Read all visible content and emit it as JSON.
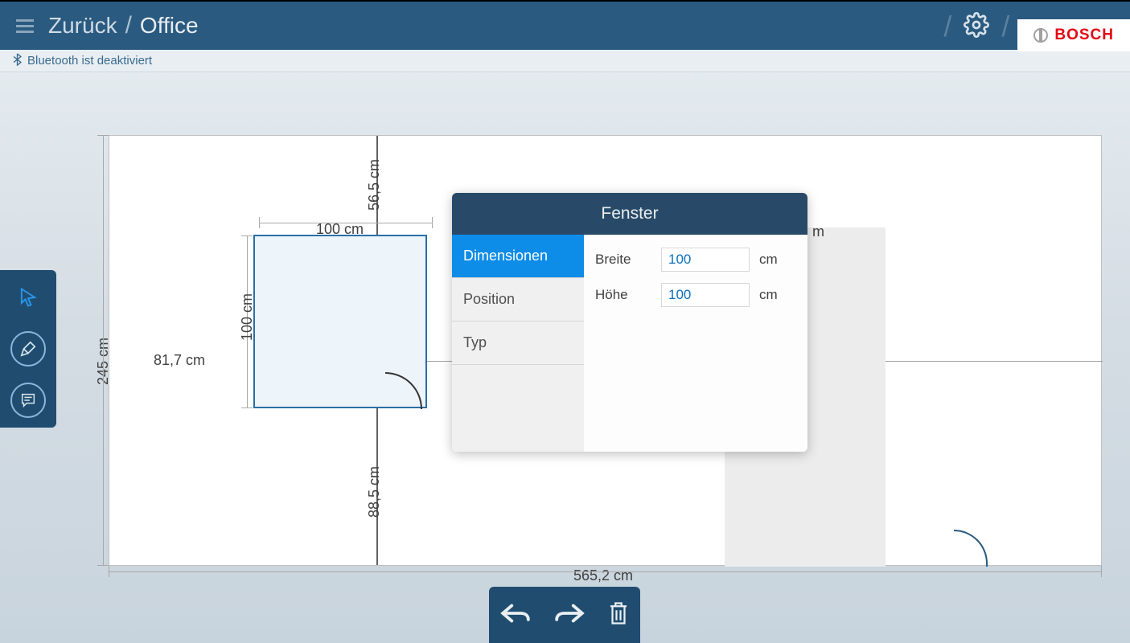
{
  "header": {
    "back": "Zurück",
    "title": "Office",
    "brand": "BOSCH"
  },
  "status": {
    "text": "Bluetooth ist deaktiviert"
  },
  "dimensions": {
    "room_height": "245 cm",
    "room_width": "565,2 cm",
    "left_width": "81,7 cm",
    "top_seg": "56,5 cm",
    "bottom_seg": "88,5 cm",
    "win_w": "100 cm",
    "win_h": "100 cm",
    "ext": "m"
  },
  "panel": {
    "title": "Fenster",
    "tabs": {
      "dim": "Dimensionen",
      "pos": "Position",
      "typ": "Typ"
    },
    "fields": {
      "width_label": "Breite",
      "width_value": "100",
      "height_label": "Höhe",
      "height_value": "100",
      "unit": "cm"
    }
  }
}
